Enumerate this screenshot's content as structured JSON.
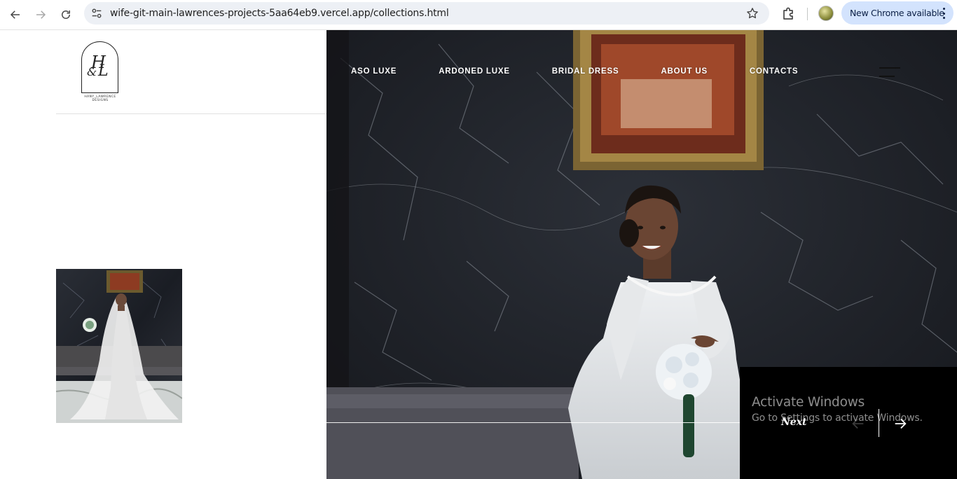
{
  "browser": {
    "url": "wife-git-main-lawrences-projects-5aa64eb9.vercel.app/collections.html",
    "update_label": "New Chrome available",
    "icons": {
      "back": "arrow-left-icon",
      "forward": "arrow-right-icon",
      "reload": "reload-icon",
      "site_info": "tune-icon",
      "bookmark": "star-icon",
      "extensions": "puzzle-icon",
      "menu": "kebab-icon"
    }
  },
  "site": {
    "logo": {
      "monogram": {
        "h": "H",
        "amp": "&",
        "l": "L"
      },
      "caption": "HANY_LAWRENCE DESIGNS"
    },
    "nav": [
      {
        "label": "ASO LUXE"
      },
      {
        "label": "ARDONED LUXE"
      },
      {
        "label": "BRIDAL DRESS"
      },
      {
        "label": "ABOUT US"
      },
      {
        "label": "CONTACTS"
      }
    ],
    "menu_icon": "hamburger-icon",
    "slider": {
      "next_label": "Next",
      "prev_icon": "arrow-left-icon",
      "next_icon": "arrow-right-icon"
    }
  },
  "os_overlay": {
    "title": "Activate Windows",
    "subtitle": "Go to Settings to activate Windows."
  },
  "colors": {
    "chrome_bg": "#ffffff",
    "omnibox_bg": "#edf0f5",
    "update_pill": "#d3e3fd",
    "slider_box": "#000000",
    "nav_text": "#ffffff"
  }
}
